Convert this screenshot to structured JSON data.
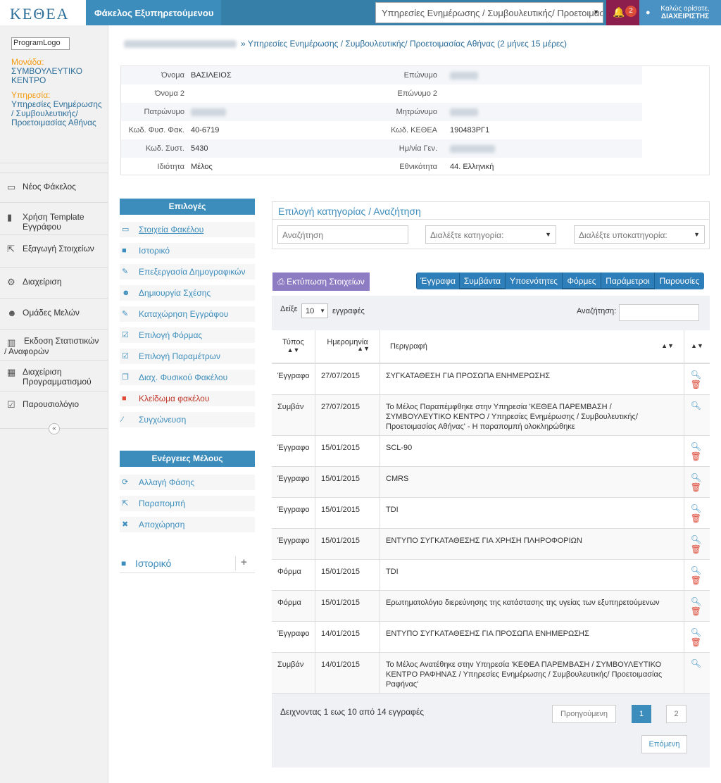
{
  "header": {
    "logo": "KEΘEA",
    "app_title": "Φάκελος Εξυπηρετούμενου",
    "service_select": "Υπηρεσίες Ενημέρωσης / Συμβουλευτικής/ Προετοιμασία",
    "notifications": "2",
    "greeting": "Καλώς ορίσατε,",
    "user": "ΔΙΑΧΕΙΡΙΣΤΗΣ"
  },
  "sidebar": {
    "logo_alt": "ProgramLogo",
    "unit_label": "Μονάδα:",
    "unit_value": "ΣΥΜΒΟΥΛΕΥΤΙΚΟ ΚΕΝΤΡΟ",
    "service_label": "Υπηρεσία:",
    "service_value": "Υπηρεσίες Ενημέρωσης / Συμβουλευτικής/ Προετοιμασίας Αθήνας",
    "items": [
      {
        "label": "Νέος Φάκελος"
      },
      {
        "label": "Χρήση Template Εγγράφου"
      },
      {
        "label": "Εξαγωγή Στοιχείων"
      },
      {
        "label": "Διαχείριση"
      },
      {
        "label": "Ομάδες Μελών"
      },
      {
        "label": "Εκδοση Στατιστικών / Αναφορών"
      },
      {
        "label": "Διαχείριση Προγραμματισμού"
      },
      {
        "label": "Παρουσιολόγιο"
      }
    ],
    "collapse": "«"
  },
  "breadcrumb": "» Υπηρεσίες Ενημέρωσης / Συμβουλευτικής/ Προετοιμασίας Αθήνας (2 μήνες 15 μέρες)",
  "person": {
    "rows": [
      {
        "l1": "Όνομα",
        "v1": "ΒΑΣΙΛΕΙΟΣ",
        "l2": "Επώνυμο",
        "v2": ""
      },
      {
        "l1": "Όνομα 2",
        "v1": "",
        "l2": "Επώνυμο 2",
        "v2": ""
      },
      {
        "l1": "Πατρώνυμο",
        "v1": "",
        "l2": "Μητρώνυμο",
        "v2": ""
      },
      {
        "l1": "Κωδ. Φυσ. Φακ.",
        "v1": "40-6719",
        "l2": "Κωδ. ΚΕΘΕΑ",
        "v2": "190483ΡΓ1"
      },
      {
        "l1": "Κωδ. Συστ.",
        "v1": "5430",
        "l2": "Ημ/νία Γεν.",
        "v2": ""
      },
      {
        "l1": "Ιδιότητα",
        "v1": "Μέλος",
        "l2": "Εθνικότητα",
        "v2": "44. Ελληνική"
      }
    ]
  },
  "options": {
    "title": "Επιλογές",
    "items": [
      {
        "label": "Στοιχεία Φακέλου",
        "icon": "folder-icon",
        "glyph": "▭"
      },
      {
        "label": "Ιστορικό",
        "icon": "book-icon",
        "glyph": "■"
      },
      {
        "label": "Επεξεργασία Δημογραφικών",
        "icon": "pencil-icon",
        "glyph": "✎"
      },
      {
        "label": "Δημιουργία Σχέσης",
        "icon": "users-icon",
        "glyph": "☻"
      },
      {
        "label": "Καταχώρηση Εγγράφου",
        "icon": "edit-icon",
        "glyph": "✎"
      },
      {
        "label": "Επιλογή Φόρμας",
        "icon": "check-icon",
        "glyph": "☑"
      },
      {
        "label": "Επιλογή Παραμέτρων",
        "icon": "checkbox-icon",
        "glyph": "☑"
      },
      {
        "label": "Διαχ. Φυσικού Φακέλου",
        "icon": "copy-icon",
        "glyph": "❐"
      },
      {
        "label": "Κλείδωμα φακέλου",
        "icon": "lock-icon",
        "glyph": "■"
      },
      {
        "label": "Συγχώνευση",
        "icon": "magic-icon",
        "glyph": "⁄"
      }
    ]
  },
  "member_actions": {
    "title": "Ενέργειες Μέλους",
    "items": [
      {
        "label": "Αλλαγή Φάσης",
        "glyph": "⟳"
      },
      {
        "label": "Παραπομπή",
        "glyph": "⇱"
      },
      {
        "label": "Αποχώρηση",
        "glyph": "✖"
      }
    ]
  },
  "history_panel": {
    "title": "Ιστορικό",
    "add": "+"
  },
  "search": {
    "title": "Επιλογή κατηγορίας / Αναζήτηση",
    "placeholder": "Αναζήτηση",
    "category": "Διαλέξτε κατηγορία:",
    "subcategory": "Διαλέξτε υποκατηγορία:"
  },
  "toolbar": {
    "print": "Εκτύπωση Στοιχείων",
    "tabs": [
      "Έγγραφα",
      "Συμβάντα",
      "Υποενότητες",
      "Φόρμες",
      "Παράμετροι",
      "Παρουσίες"
    ]
  },
  "table": {
    "show": "Δείξε",
    "length": "10",
    "entries": "εγγραφές",
    "search_label": "Αναζήτηση:",
    "columns": [
      "Τύπος",
      "Ημερομηνία",
      "Περιγραφή"
    ],
    "rows": [
      {
        "type": "Έγγραφο",
        "date": "27/07/2015",
        "desc": "ΣΥΓΚΑΤΑΘΕΣΗ ΓΙΑ ΠΡΟΣΩΠΑ ΕΝΗΜΕΡΩΣΗΣ",
        "del": true
      },
      {
        "type": "Συμβάν",
        "date": "27/07/2015",
        "desc": "Το Μέλος Παραπέμφθηκε στην Υπηρεσία 'ΚΕΘΕΑ ΠΑΡΕΜΒΑΣΗ / ΣΥΜΒΟΥΛΕΥΤΙΚΟ ΚΕΝΤΡΟ / Υπηρεσίες Ενημέρωσης / Συμβουλευτικής/ Προετοιμασίας Αθήνας' - Η παραπομπή ολοκληρώθηκε",
        "del": false
      },
      {
        "type": "Έγγραφο",
        "date": "15/01/2015",
        "desc": "SCL-90",
        "del": true
      },
      {
        "type": "Έγγραφο",
        "date": "15/01/2015",
        "desc": "CMRS",
        "del": true
      },
      {
        "type": "Έγγραφο",
        "date": "15/01/2015",
        "desc": "TDI",
        "del": true
      },
      {
        "type": "Έγγραφο",
        "date": "15/01/2015",
        "desc": "ΕΝΤΥΠΟ ΣΥΓΚΑΤΑΘΕΣΗΣ ΓΙΑ ΧΡΗΣΗ ΠΛΗΡΟΦΟΡΙΩΝ",
        "del": true
      },
      {
        "type": "Φόρμα",
        "date": "15/01/2015",
        "desc": "TDI",
        "del": true
      },
      {
        "type": "Φόρμα",
        "date": "15/01/2015",
        "desc": "Ερωτηματολόγιο διερεύνησης της κατάστασης της υγείας των εξυπηρετούμενων",
        "del": true
      },
      {
        "type": "Έγγραφο",
        "date": "14/01/2015",
        "desc": "ΕΝΤΥΠΟ ΣΥΓΚΑΤΑΘΕΣΗΣ ΓΙΑ ΠΡΟΣΩΠΑ ΕΝΗΜΕΡΩΣΗΣ",
        "del": true
      },
      {
        "type": "Συμβάν",
        "date": "14/01/2015",
        "desc": "Το Μέλος Ανατέθηκε στην Υπηρεσία 'ΚΕΘΕΑ ΠΑΡΕΜΒΑΣΗ / ΣΥΜΒΟΥΛΕΥΤΙΚΟ ΚΕΝΤΡΟ ΡΑΦΗΝΑΣ / Υπηρεσίες Ενημέρωσης / Συμβουλευτικής/ Προετοιμασίας Ραφήνας'",
        "del": false
      }
    ],
    "info": "Δειχνοντας 1 εως 10 από 14 εγγραφές",
    "prev": "Προηγούμενη",
    "pages": [
      "1",
      "2"
    ],
    "next": "Επόμενη"
  }
}
